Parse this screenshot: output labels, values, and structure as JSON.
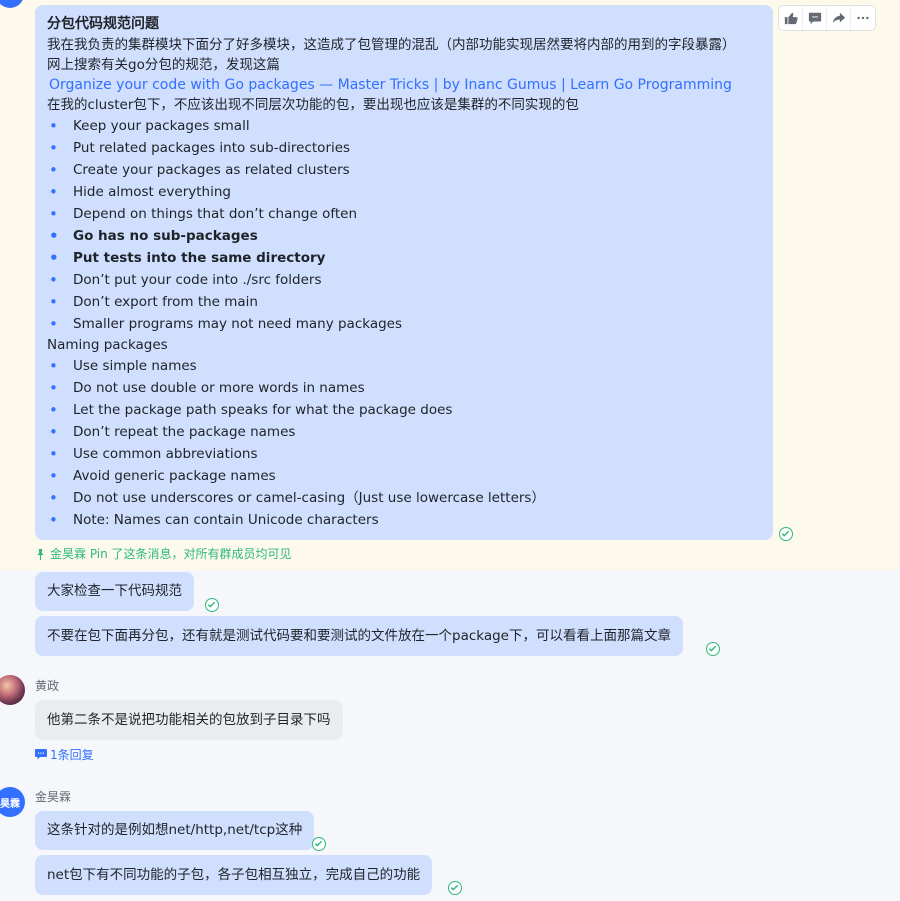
{
  "pinned_message": {
    "title": "分包代码规范问题",
    "intro_1": "我在我负责的集群模块下面分了好多模块，这造成了包管理的混乱（内部功能实现居然要将内部的用到的字段暴露）",
    "intro_2": "网上搜索有关go分包的规范，发现这篇",
    "link_text": "Organize your code with Go packages — Master Tricks | by Inanc Gumus | Learn Go Programming",
    "intro_3": "在我的cluster包下，不应该出现不同层次功能的包，要出现也应该是集群的不同实现的包",
    "list_1": [
      {
        "text": "Keep your packages small",
        "bold": false
      },
      {
        "text": "Put related packages into sub-directories",
        "bold": false
      },
      {
        "text": "Create your packages as related clusters",
        "bold": false
      },
      {
        "text": "Hide almost everything",
        "bold": false
      },
      {
        "text": "Depend on things that don’t change often",
        "bold": false
      },
      {
        "text": "Go has no sub-packages",
        "bold": true
      },
      {
        "text": "Put tests into the same directory",
        "bold": true
      },
      {
        "text": "Don’t put your code into ./src folders",
        "bold": false
      },
      {
        "text": "Don’t export from the main",
        "bold": false
      },
      {
        "text": "Smaller programs may not need many packages",
        "bold": false
      }
    ],
    "section_heading": "Naming packages",
    "list_2": [
      "Use simple names",
      "Do not use double or more words in names",
      "Let the package path speaks for what the package does",
      "Don’t repeat the package names",
      "Use common abbreviations",
      "Avoid generic package names",
      "Do not use underscores or camel-casing（Just use lowercase letters）",
      "Note: Names can contain Unicode characters"
    ],
    "pin_note": "金昊霖 Pin 了这条消息，对所有群成员均可见"
  },
  "toolbar": {
    "icons": [
      "thumbs-up-icon",
      "comment-icon",
      "forward-icon",
      "more-icon"
    ]
  },
  "messages": [
    {
      "text": "大家检查一下代码规范"
    },
    {
      "text": "不要在包下面再分包，还有就是测试代码要和要测试的文件放在一个package下，可以看看上面那篇文章"
    },
    {
      "sender": "黄政",
      "text": "他第二条不是说把功能相关的包放到子目录下吗",
      "reply_label": "1条回复"
    },
    {
      "sender": "金昊霖",
      "avatar_text": "昊霖",
      "text": "这条针对的是例如想net/http,net/tcp这种"
    },
    {
      "text": "net包下有不同功能的子包，各子包相互独立，完成自己的功能"
    }
  ],
  "colors": {
    "accent": "#3370ff",
    "read_check": "#2eb87a",
    "bubble_self": "#cfdffd",
    "bubble_other": "#ebecee",
    "pinned_background": "#fdfaec"
  }
}
